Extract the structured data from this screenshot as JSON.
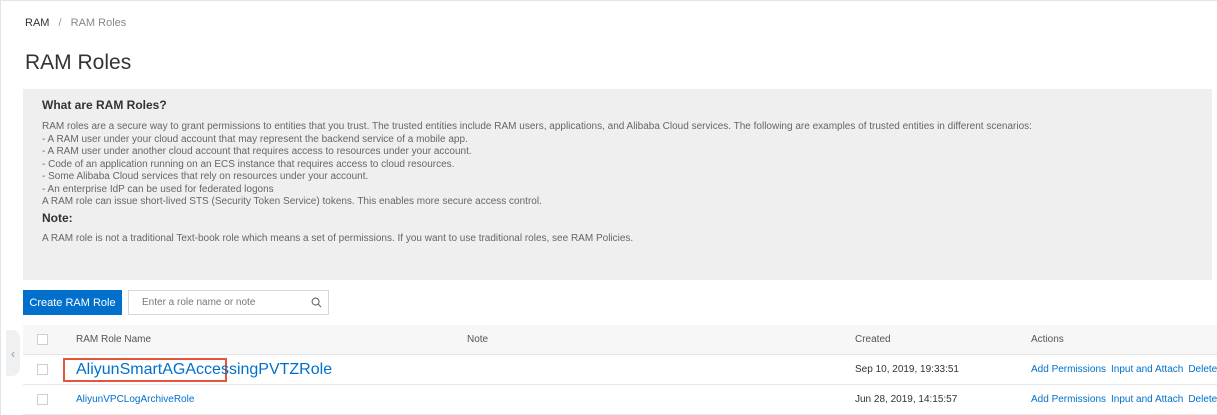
{
  "breadcrumb": {
    "root": "RAM",
    "separator": "/",
    "current": "RAM Roles"
  },
  "page_title": "RAM Roles",
  "info": {
    "title": "What are RAM Roles?",
    "lines": [
      "RAM roles are a secure way to grant permissions to entities that you trust. The trusted entities include RAM users, applications, and Alibaba Cloud services. The following are examples of trusted entities in different scenarios:",
      "- A RAM user under your cloud account that may represent the backend service of a mobile app.",
      "- A RAM user under another cloud account that requires access to resources under your account.",
      "- Code of an application running on an ECS instance that requires access to cloud resources.",
      "- Some Alibaba Cloud services that rely on resources under your account.",
      "- An enterprise IdP can be used for federated logons",
      "A RAM role can issue short-lived STS (Security Token Service) tokens. This enables more secure access control."
    ],
    "note_title": "Note:",
    "note_text": "A RAM role is not a traditional Text-book role which means a set of permissions. If you want to use traditional roles, see RAM Policies."
  },
  "toolbar": {
    "create_label": "Create RAM Role",
    "search_placeholder": "Enter a role name or note"
  },
  "table": {
    "columns": {
      "name": "RAM Role Name",
      "note": "Note",
      "created": "Created",
      "actions": "Actions"
    },
    "rows": [
      {
        "name": "AliyunSmartAGAccessingPVTZRole",
        "note": "",
        "created": "Sep 10, 2019, 19:33:51",
        "highlighted": true
      },
      {
        "name": "AliyunVPCLogArchiveRole",
        "note": "",
        "created": "Jun 28, 2019, 14:15:57",
        "highlighted": false
      }
    ],
    "actions": {
      "add_permissions": "Add Permissions",
      "input_attach": "Input and Attach",
      "delete": "Delete"
    }
  },
  "colors": {
    "accent": "#0070cc",
    "highlight": "#e0573e",
    "info_bg": "#efefef"
  },
  "icons": {
    "search": "search-icon",
    "collapse": "chevron-left-icon"
  }
}
